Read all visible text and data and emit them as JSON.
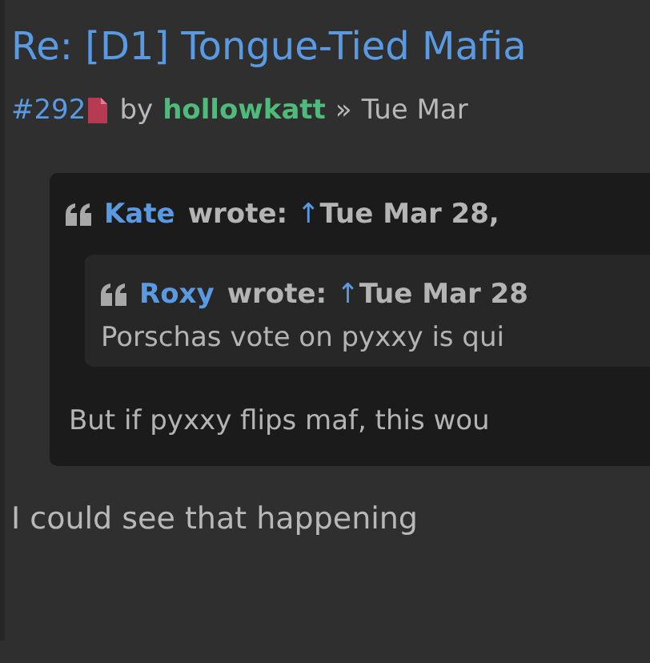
{
  "post": {
    "title": "Re: [D1] Tongue-Tied Mafia",
    "number": "#292",
    "by": "by",
    "author": "hollowkatt",
    "separator": "»",
    "date": "Tue Mar"
  },
  "quote": {
    "author": "Kate",
    "wrote": "wrote:",
    "arrow": "↑",
    "date": "Tue Mar 28,",
    "nested_quote": {
      "author": "Roxy",
      "wrote": "wrote:",
      "arrow": "↑",
      "date": "Tue Mar 28",
      "text": "Porschas vote on pyxxy is qui"
    },
    "text": "But if pyxxy flips maf, this wou"
  },
  "body": "I could see that happening"
}
